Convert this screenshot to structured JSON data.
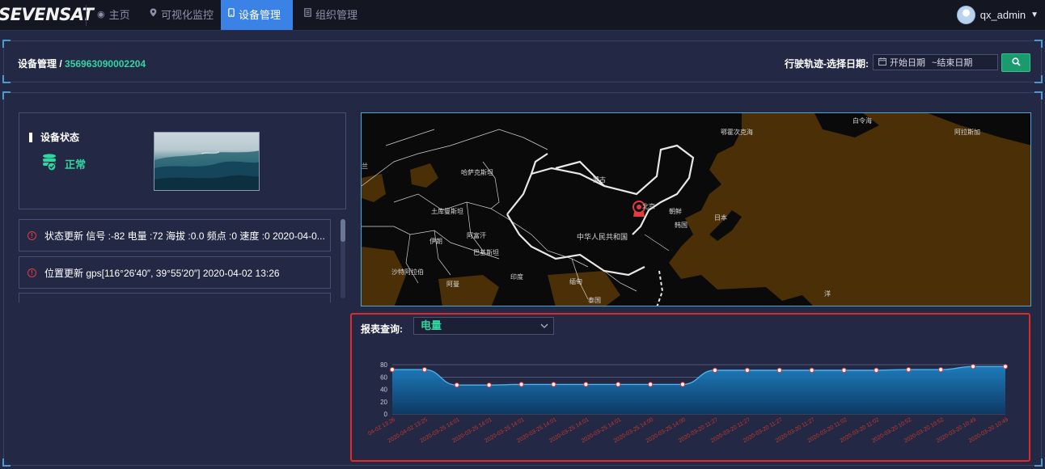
{
  "brand": "SEVENSAT",
  "nav": {
    "items": [
      {
        "label": "主页",
        "icon": "home-icon"
      },
      {
        "label": "可视化监控",
        "icon": "location-pin-icon"
      },
      {
        "label": "设备管理",
        "icon": "device-icon",
        "active": true
      },
      {
        "label": "组织管理",
        "icon": "document-icon"
      }
    ]
  },
  "user": {
    "name": "qx_admin"
  },
  "breadcrumb": {
    "root": "设备管理 / ",
    "device_id": "356963090002204"
  },
  "track": {
    "label": "行驶轨迹-选择日期:",
    "start_placeholder": "开始日期",
    "end_placeholder": "~结束日期"
  },
  "status": {
    "title": "设备状态",
    "value": "正常"
  },
  "logs": [
    {
      "text": "状态更新 信号 :-82 电量 :72 海拔 :0.0 频点 :0 速度 :0 2020-04-0..."
    },
    {
      "text": "位置更新 gps[116°26′40″, 39°55′20″] 2020-04-02 13:26"
    }
  ],
  "map": {
    "labels": {
      "bering": "鄂霍次克海",
      "alaska_sea": "白令海",
      "canada": "阿拉斯加",
      "kazakh": "哈萨克斯坦",
      "mongolia": "蒙古",
      "turkmen": "土库曼斯坦",
      "iran": "伊朗",
      "afghan": "阿富汗",
      "pakistan": "巴基斯坦",
      "saudi": "沙特阿拉伯",
      "oman": "阿曼",
      "india": "印度",
      "myanmar": "缅甸",
      "thailand": "泰国",
      "china": "中华人民共和国",
      "beijing": "北京",
      "korea": "韩国",
      "japan": "日本",
      "fr": "朝鲜",
      "iraq": "伊拉克",
      "sea": "孟加拉湾",
      "pacific": "洋",
      "yemen": "也门",
      "a": "兰"
    },
    "colors": {
      "land": "#111111",
      "water": "#4a2f07",
      "border": "#ffffff",
      "marker": "#e23b3b"
    }
  },
  "report": {
    "label": "报表查询:",
    "selected": "电量"
  },
  "chart_data": {
    "type": "area",
    "series": [
      {
        "values": [
          72,
          72,
          47,
          47,
          48,
          48,
          48,
          48,
          48,
          48,
          71,
          71,
          71,
          71,
          71,
          71,
          72,
          72,
          77,
          77
        ]
      }
    ],
    "x": [
      "04-02 13:26",
      "2020-04-02 13:25",
      "2020-03-25 14:01",
      "2020-03-25 14:01",
      "2020-03-25 14:01",
      "2020-03-25 14:01",
      "2020-03-25 14:01",
      "2020-03-25 14:01",
      "2020-03-25 14:00",
      "2020-03-25 14:00",
      "2020-03-20 11:27",
      "2020-03-20 11:27",
      "2020-03-20 11:27",
      "2020-03-20 11:27",
      "2020-03-20 11:02",
      "2020-03-20 11:02",
      "2020-03-20 10:52",
      "2020-03-20 10:52",
      "2020-03-20 10:49",
      "2020-03-20 10:49"
    ],
    "yticks": [
      0,
      20,
      40,
      60,
      80
    ],
    "ylim": [
      0,
      80
    ],
    "grid": true,
    "colors": {
      "fill_top": "#1e7fc0",
      "fill_bottom": "#0b3a66",
      "line": "#4fb0ea",
      "point": "#ffffff",
      "point_stroke": "#e23b3b"
    }
  }
}
